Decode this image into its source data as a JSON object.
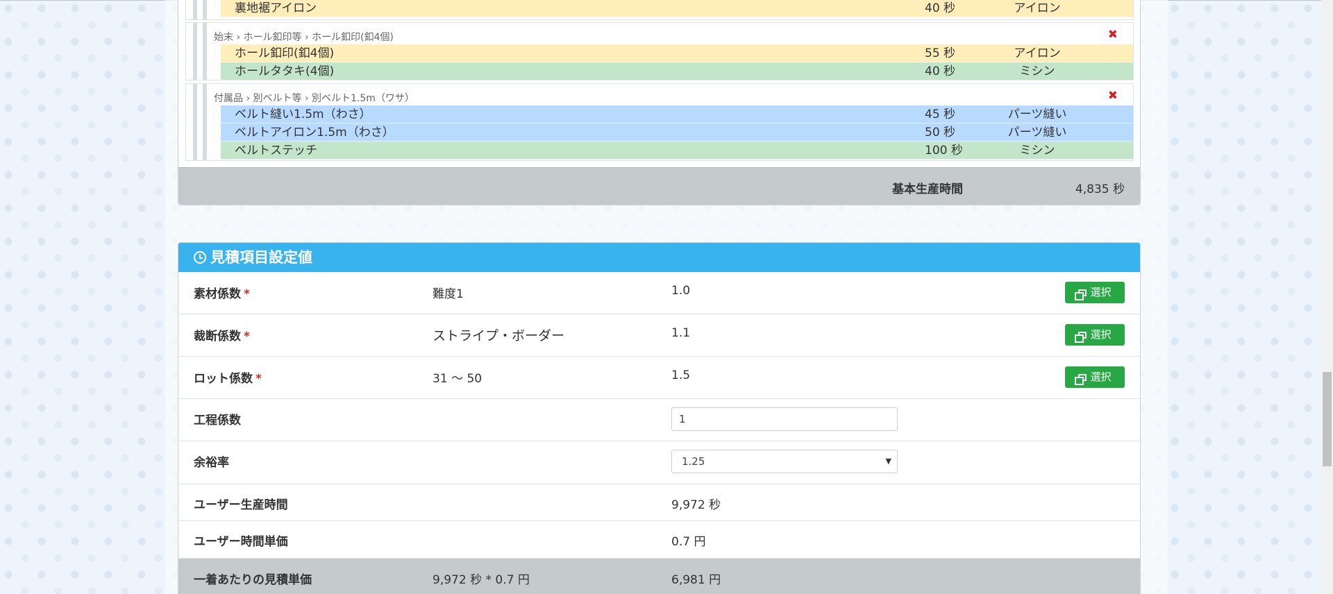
{
  "process_groups": [
    {
      "path": "",
      "rows": [
        {
          "name": "裏地裾アイロン",
          "time": "40 秒",
          "type": "アイロン",
          "color": "yellow"
        }
      ]
    },
    {
      "path": "始末 › ホール釦印等 › ホール釦印(釦4個)",
      "rows": [
        {
          "name": "ホール釦印(釦4個)",
          "time": "55 秒",
          "type": "アイロン",
          "color": "yellow"
        },
        {
          "name": "ホールタタキ(4個)",
          "time": "40 秒",
          "type": "ミシン",
          "color": "green"
        }
      ]
    },
    {
      "path": "付属品 › 別ベルト等 › 別ベルト1.5m（ワサ）",
      "rows": [
        {
          "name": "ベルト縫い1.5m（わさ）",
          "time": "45 秒",
          "type": "パーツ縫い",
          "color": "blue"
        },
        {
          "name": "ベルトアイロン1.5m（わさ）",
          "time": "50 秒",
          "type": "パーツ縫い",
          "color": "blue"
        },
        {
          "name": "ベルトステッチ",
          "time": "100 秒",
          "type": "ミシン",
          "color": "green"
        }
      ]
    }
  ],
  "base_production": {
    "label": "基本生産時間",
    "value": "4,835 秒"
  },
  "settings": {
    "title": "見積項目設定値",
    "select_label": "選択",
    "material": {
      "label": "素材係数",
      "selected": "難度1",
      "value": "1.0"
    },
    "cutting": {
      "label": "裁断係数",
      "selected": "ストライプ・ボーダー",
      "value": "1.1"
    },
    "lot": {
      "label": "ロット係数",
      "selected": "31 ～ 50",
      "value": "1.5"
    },
    "process": {
      "label": "工程係数",
      "input_value": "1"
    },
    "margin": {
      "label": "余裕率",
      "selected_option": "1.25"
    },
    "user_production": {
      "label": "ユーザー生産時間",
      "value": "9,972 秒"
    },
    "user_rate": {
      "label": "ユーザー時間単価",
      "value": "0.7 円"
    },
    "unit_price": {
      "label": "一着あたりの見積単価",
      "formula": "9,972 秒 * 0.7 円",
      "value": "6,981 円"
    }
  },
  "colors": {
    "yellow": "#ffeeba",
    "green": "#c3e6cb",
    "blue": "#b8daff",
    "header": "#38b3ee",
    "button": "#28a745"
  }
}
